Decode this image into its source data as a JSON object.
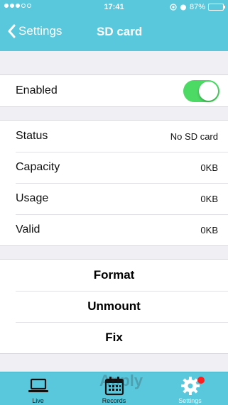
{
  "status_bar": {
    "time": "17:41",
    "battery": "87%",
    "battery_level": 0.87
  },
  "nav": {
    "back_label": "Settings",
    "title": "SD card"
  },
  "enabled_row": {
    "label": "Enabled",
    "toggle_on": true
  },
  "info_rows": [
    {
      "label": "Status",
      "value": "No SD card"
    },
    {
      "label": "Capacity",
      "value": "0KB"
    },
    {
      "label": "Usage",
      "value": "0KB"
    },
    {
      "label": "Valid",
      "value": "0KB"
    }
  ],
  "actions": [
    {
      "label": "Format"
    },
    {
      "label": "Unmount"
    },
    {
      "label": "Fix"
    }
  ],
  "tabs": [
    {
      "label": "Live",
      "icon": "laptop-icon"
    },
    {
      "label": "Records",
      "icon": "calendar-icon"
    },
    {
      "label": "Settings",
      "icon": "gear-icon"
    }
  ],
  "ghost_text": "Apply",
  "colors": {
    "accent": "#5ac8dc",
    "toggle_on": "#4cd964",
    "badge": "#ff1f1f"
  }
}
